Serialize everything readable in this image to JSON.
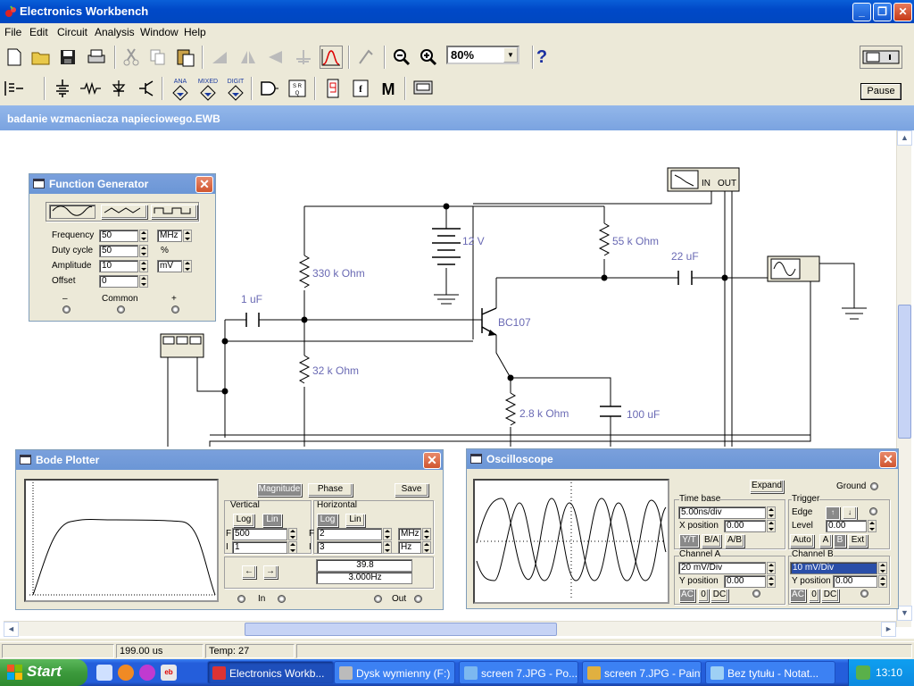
{
  "app": {
    "title": "Electronics Workbench"
  },
  "menu": [
    "File",
    "Edit",
    "Circuit",
    "Analysis",
    "Window",
    "Help"
  ],
  "toolbar": {
    "zoom": "80%",
    "help": "?",
    "pause": "Pause"
  },
  "document": {
    "title": "badanie wzmacniacza napieciowego.EWB"
  },
  "circuit": {
    "labels": {
      "battery": "12 V",
      "r_top_left": "330 k Ohm",
      "r_collector": "55 k Ohm",
      "c_out": "22 uF",
      "c_in": "1 uF",
      "transistor": "BC107",
      "r_bottom_left": "32 k Ohm",
      "r_emitter": "2.8 k Ohm",
      "c_emitter": "100 uF",
      "bode_in": "IN",
      "bode_out": "OUT"
    }
  },
  "function_generator": {
    "title": "Function Generator",
    "rows": [
      {
        "label": "Frequency",
        "value": "50",
        "unit": "MHz"
      },
      {
        "label": "Duty cycle",
        "value": "50",
        "unit": "%"
      },
      {
        "label": "Amplitude",
        "value": "10",
        "unit": "mV"
      },
      {
        "label": "Offset",
        "value": "0",
        "unit": ""
      }
    ],
    "terminals": {
      "minus": "–",
      "common": "Common",
      "plus": "+"
    }
  },
  "bode": {
    "title": "Bode Plotter",
    "mode_magnitude": "Magnitude",
    "mode_phase": "Phase",
    "save": "Save",
    "vertical": {
      "title": "Vertical",
      "log": "Log",
      "lin": "Lin",
      "f_value": "500",
      "i_value": "1"
    },
    "horizontal": {
      "title": "Horizontal",
      "log": "Log",
      "lin": "Lin",
      "f_value": "2",
      "f_unit": "MHz",
      "i_value": "3",
      "i_unit": "Hz"
    },
    "f_label": "F",
    "i_label": "I",
    "readout_value": "39.8",
    "readout_freq": "3.000Hz",
    "in_label": "In",
    "out_label": "Out"
  },
  "oscilloscope": {
    "title": "Oscilloscope",
    "expand": "Expand",
    "ground": "Ground",
    "timebase": {
      "title": "Time base",
      "value": "5.00ns/div",
      "xpos_label": "X position",
      "xpos": "0.00",
      "modes": [
        "Y/T",
        "B/A",
        "A/B"
      ]
    },
    "trigger": {
      "title": "Trigger",
      "edge_label": "Edge",
      "level_label": "Level",
      "level": "0.00",
      "buttons": [
        "Auto",
        "A",
        "B",
        "Ext"
      ]
    },
    "channel_a": {
      "title": "Channel A",
      "value": "20 mV/Div",
      "ypos_label": "Y position",
      "ypos": "0.00",
      "coupling": [
        "AC",
        "0",
        "DC"
      ]
    },
    "channel_b": {
      "title": "Channel B",
      "value": "10 mV/Div",
      "ypos_label": "Y position",
      "ypos": "0.00",
      "coupling": [
        "AC",
        "0",
        "DC"
      ]
    }
  },
  "status": {
    "time": "199.00 us",
    "temp": "Temp:  27"
  },
  "taskbar": {
    "start": "Start",
    "tasks": [
      "Electronics Workb...",
      "Dysk wymienny (F:)",
      "screen 7.JPG - Po...",
      "screen 7.JPG - Paint",
      "Bez tytułu - Notat..."
    ],
    "clock": "13:10"
  }
}
